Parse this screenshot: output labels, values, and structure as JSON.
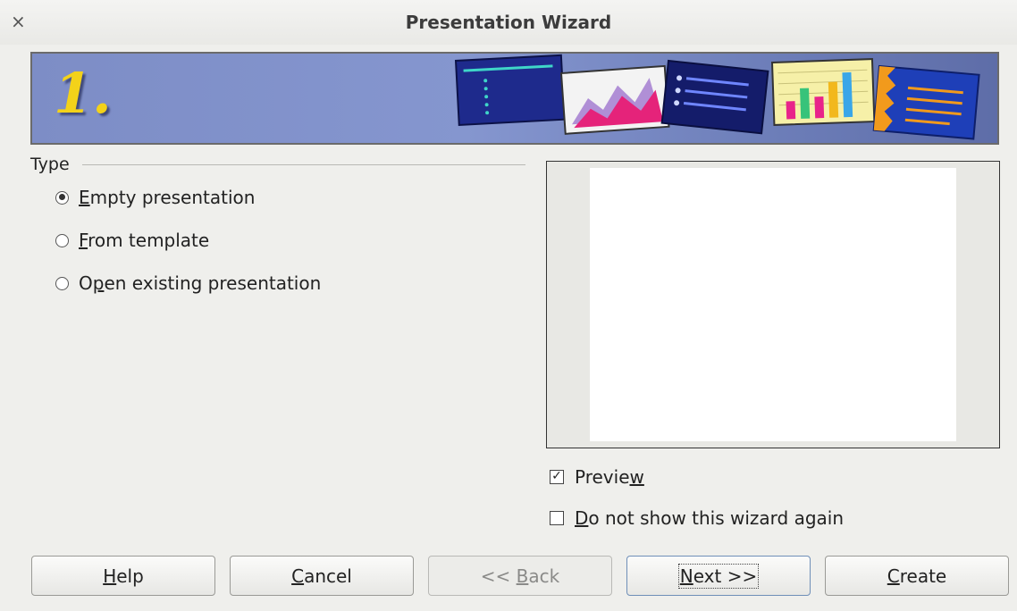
{
  "window": {
    "title": "Presentation Wizard",
    "close_glyph": "×"
  },
  "banner": {
    "step": "1."
  },
  "type_group": {
    "label": "Type",
    "options": [
      {
        "mnemonic": "E",
        "rest": "mpty presentation",
        "selected": true
      },
      {
        "mnemonic": "F",
        "rest": "rom template",
        "selected": false
      },
      {
        "pre": "O",
        "mnemonic": "p",
        "rest": "en existing presentation",
        "selected": false
      }
    ]
  },
  "preview_checkbox": {
    "pre": "Previe",
    "mnemonic": "w",
    "checked": true,
    "check_glyph": "✓"
  },
  "dont_show_checkbox": {
    "mnemonic": "D",
    "rest": "o not show this wizard again",
    "checked": false
  },
  "buttons": {
    "help": {
      "mnemonic": "H",
      "rest": "elp"
    },
    "cancel": {
      "mnemonic": "C",
      "rest": "ancel"
    },
    "back": {
      "pre": "<< ",
      "mnemonic": "B",
      "rest": "ack",
      "disabled": true
    },
    "next": {
      "mnemonic": "N",
      "rest": "ext >>",
      "focused": true
    },
    "create": {
      "mnemonic": "C",
      "rest": "reate"
    }
  }
}
